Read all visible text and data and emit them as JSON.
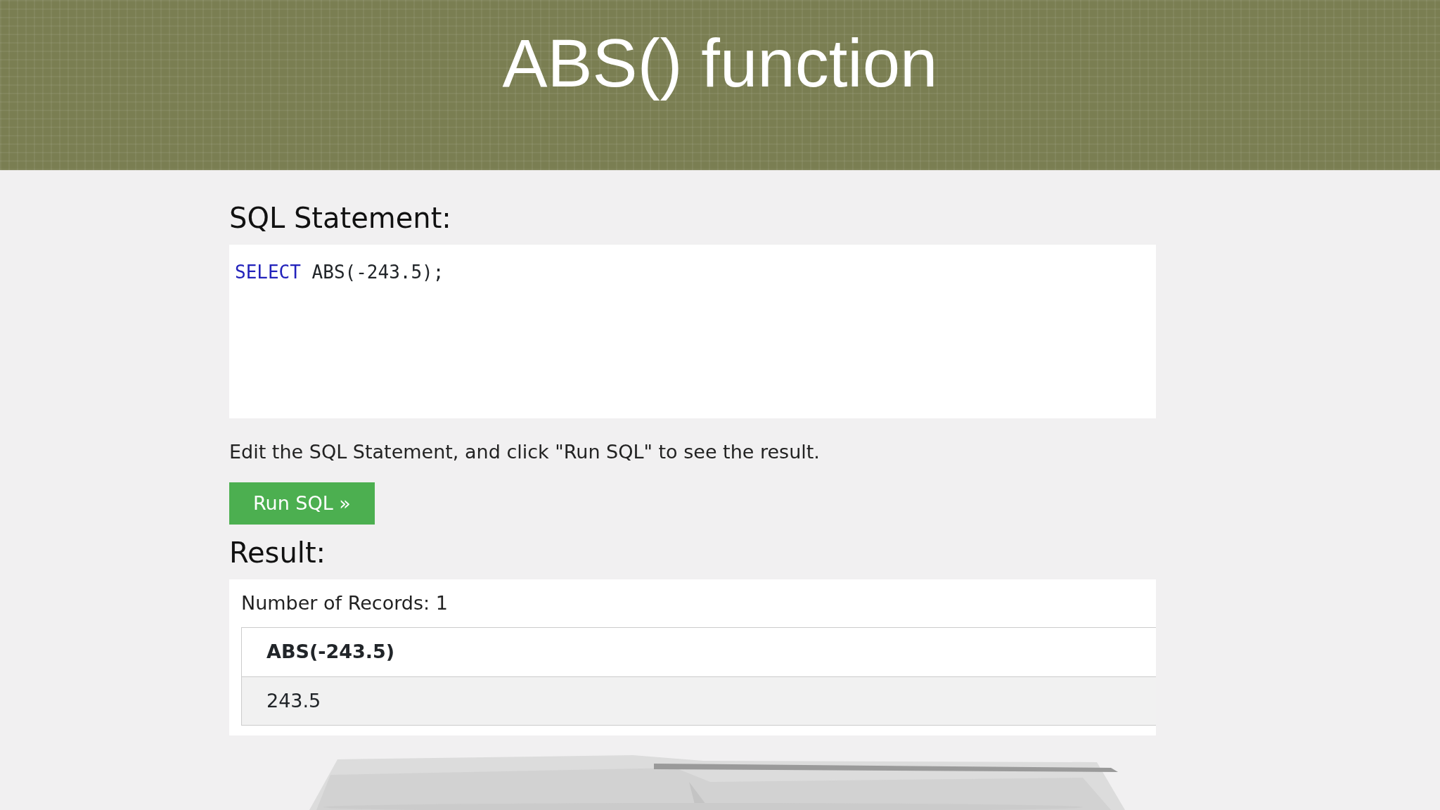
{
  "slide_title": "ABS() function",
  "editor": {
    "heading": "SQL Statement:",
    "code": [
      {
        "kind": "keyword",
        "text": "SELECT"
      },
      {
        "kind": "plain",
        "text": " ABS(-243.5);"
      }
    ],
    "hint": "Edit the SQL Statement, and click \"Run SQL\" to see the result.",
    "button": "Run SQL »"
  },
  "result": {
    "heading": "Result:",
    "records": "Number of Records: 1",
    "table": {
      "columns": [
        "ABS(-243.5)"
      ],
      "rows": [
        [
          "243.5"
        ]
      ]
    }
  }
}
